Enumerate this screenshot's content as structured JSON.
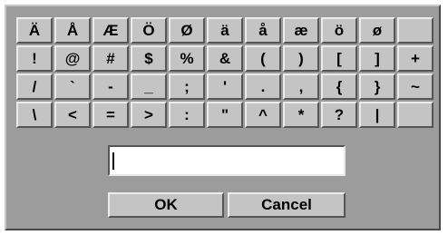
{
  "keyboard": {
    "rows": [
      [
        "Ä",
        "Å",
        "Æ",
        "Ö",
        "Ø",
        "ä",
        "å",
        "æ",
        "ö",
        "ø",
        ""
      ],
      [
        "!",
        "@",
        "#",
        "$",
        "%",
        "&",
        "(",
        ")",
        "[",
        "]",
        "+"
      ],
      [
        "/",
        "`",
        "-",
        "_",
        ";",
        "'",
        ".",
        ",",
        "{",
        "}",
        "~"
      ],
      [
        "\\",
        "<",
        "=",
        ">",
        ":",
        "\"",
        "^",
        "*",
        "?",
        "|",
        ""
      ]
    ]
  },
  "input": {
    "value": ""
  },
  "buttons": {
    "ok_label": "OK",
    "cancel_label": "Cancel"
  },
  "colors": {
    "dialog_bg": "#9c9c9c",
    "key_bg": "#c4c4c4",
    "input_bg": "#ffffff"
  }
}
